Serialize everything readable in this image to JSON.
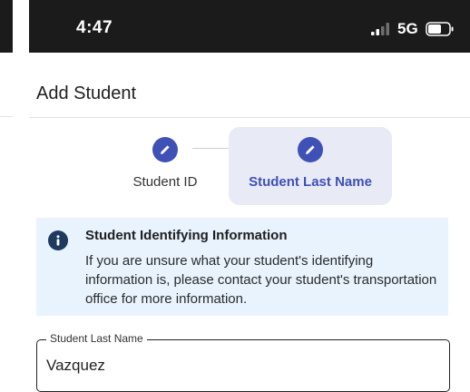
{
  "status_bar": {
    "time": "4:47",
    "network": "5G",
    "signal_icon": "signal-bars-icon",
    "battery_icon": "battery-icon"
  },
  "header": {
    "title": "Add Student"
  },
  "stepper": {
    "steps": [
      {
        "label": "Student ID",
        "icon": "pencil-icon",
        "active": false
      },
      {
        "label": "Student Last Name",
        "icon": "pencil-icon",
        "active": true
      }
    ]
  },
  "info": {
    "icon": "info-icon",
    "title": "Student Identifying Information",
    "body": "If you are unsure what your student's identifying information is, please contact your student's transportation office for more information."
  },
  "field": {
    "label": "Student Last Name",
    "value": "Vazquez"
  },
  "colors": {
    "primary": "#3f51b5",
    "active_step_bg": "#e8eaf6",
    "info_bg": "#e8f3fd",
    "status_bar_bg": "#1b1b1b"
  }
}
